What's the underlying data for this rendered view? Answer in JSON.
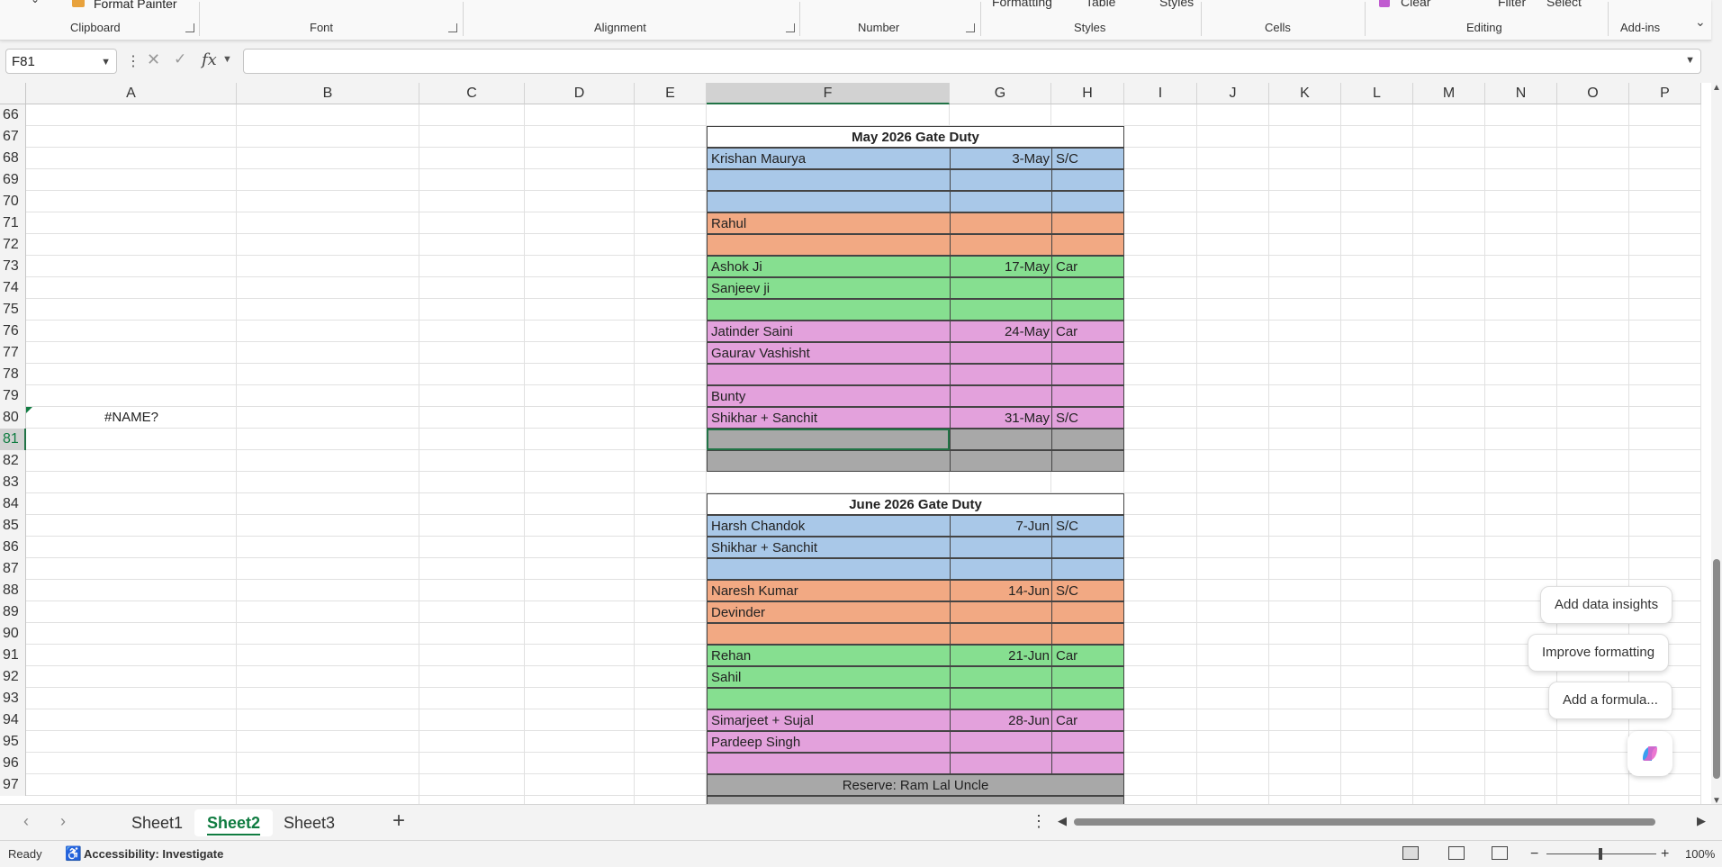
{
  "ribbon": {
    "format_painter": "Format Painter",
    "partial_top": [
      "Formatting",
      "Table",
      "Styles",
      "Clear",
      "Filter",
      "Select"
    ],
    "groups": [
      "Clipboard",
      "Font",
      "Alignment",
      "Number",
      "Styles",
      "Cells",
      "Editing",
      "Add-ins"
    ]
  },
  "formula_bar": {
    "name_box": "F81",
    "fx": "fx",
    "formula": ""
  },
  "columns": [
    "A",
    "B",
    "C",
    "D",
    "E",
    "F",
    "G",
    "H",
    "I",
    "J",
    "K",
    "L",
    "M",
    "N",
    "O",
    "P"
  ],
  "selected_column": "F",
  "rows": [
    66,
    67,
    68,
    69,
    70,
    71,
    72,
    73,
    74,
    75,
    76,
    77,
    78,
    79,
    80,
    81,
    82,
    83,
    84,
    85,
    86,
    87,
    88,
    89,
    90,
    91,
    92,
    93,
    94,
    95,
    96,
    97
  ],
  "selected_row": 81,
  "cell_a80": "#NAME?",
  "colors": {
    "blue": "#a9c8e8",
    "orange": "#f2a983",
    "green": "#86df90",
    "pink": "#e3a1dc",
    "gray": "#a8a8a8",
    "accent": "#217346"
  },
  "may_table": {
    "title": "May 2026 Gate Duty",
    "rows": [
      {
        "row": 68,
        "name": "Krishan Maurya",
        "date": "3-May",
        "type": "S/C",
        "color": "blue"
      },
      {
        "row": 69,
        "name": "",
        "date": "",
        "type": "",
        "color": "blue"
      },
      {
        "row": 70,
        "name": "",
        "date": "",
        "type": "",
        "color": "blue"
      },
      {
        "row": 71,
        "name": "Rahul",
        "date": "",
        "type": "",
        "color": "orange"
      },
      {
        "row": 72,
        "name": "",
        "date": "",
        "type": "",
        "color": "orange"
      },
      {
        "row": 73,
        "name": "Ashok Ji",
        "date": "17-May",
        "type": "Car",
        "color": "green"
      },
      {
        "row": 74,
        "name": "Sanjeev ji",
        "date": "",
        "type": "",
        "color": "green"
      },
      {
        "row": 75,
        "name": "",
        "date": "",
        "type": "",
        "color": "green"
      },
      {
        "row": 76,
        "name": "Jatinder Saini",
        "date": "24-May",
        "type": "Car",
        "color": "pink"
      },
      {
        "row": 77,
        "name": "Gaurav Vashisht",
        "date": "",
        "type": "",
        "color": "pink"
      },
      {
        "row": 78,
        "name": "",
        "date": "",
        "type": "",
        "color": "pink"
      },
      {
        "row": 79,
        "name": "Bunty",
        "date": "",
        "type": "",
        "color": "pink"
      },
      {
        "row": 80,
        "name": "Shikhar + Sanchit",
        "date": "31-May",
        "type": "S/C",
        "color": "pink"
      },
      {
        "row": 81,
        "name": "",
        "date": "",
        "type": "",
        "color": "gray"
      },
      {
        "row": 82,
        "name": "",
        "date": "",
        "type": "",
        "color": "gray"
      }
    ]
  },
  "june_table": {
    "title": "June  2026 Gate Duty",
    "rows": [
      {
        "row": 85,
        "name": "Harsh Chandok",
        "date": "7-Jun",
        "type": "S/C",
        "color": "blue"
      },
      {
        "row": 86,
        "name": "Shikhar + Sanchit",
        "date": "",
        "type": "",
        "color": "blue"
      },
      {
        "row": 87,
        "name": "",
        "date": "",
        "type": "",
        "color": "blue"
      },
      {
        "row": 88,
        "name": "Naresh Kumar",
        "date": "14-Jun",
        "type": "S/C",
        "color": "orange"
      },
      {
        "row": 89,
        "name": "Devinder",
        "date": "",
        "type": "",
        "color": "orange"
      },
      {
        "row": 90,
        "name": "",
        "date": "",
        "type": "",
        "color": "orange"
      },
      {
        "row": 91,
        "name": "Rehan",
        "date": "21-Jun",
        "type": "Car",
        "color": "green"
      },
      {
        "row": 92,
        "name": "Sahil",
        "date": "",
        "type": "",
        "color": "green"
      },
      {
        "row": 93,
        "name": "",
        "date": "",
        "type": "",
        "color": "green"
      },
      {
        "row": 94,
        "name": "Simarjeet + Sujal",
        "date": "28-Jun",
        "type": "Car",
        "color": "pink"
      },
      {
        "row": 95,
        "name": "Pardeep Singh",
        "date": "",
        "type": "",
        "color": "pink"
      },
      {
        "row": 96,
        "name": "",
        "date": "",
        "type": "",
        "color": "pink"
      }
    ],
    "reserve": "Reserve: Ram Lal Uncle"
  },
  "sheet_tabs": [
    {
      "label": "Sheet1",
      "active": false
    },
    {
      "label": "Sheet2",
      "active": true
    },
    {
      "label": "Sheet3",
      "active": false
    }
  ],
  "copilot_suggestions": [
    "Add data insights",
    "Improve formatting",
    "Add a formula..."
  ],
  "status_bar": {
    "ready": "Ready",
    "accessibility": "Accessibility: Investigate",
    "zoom": "100%"
  }
}
